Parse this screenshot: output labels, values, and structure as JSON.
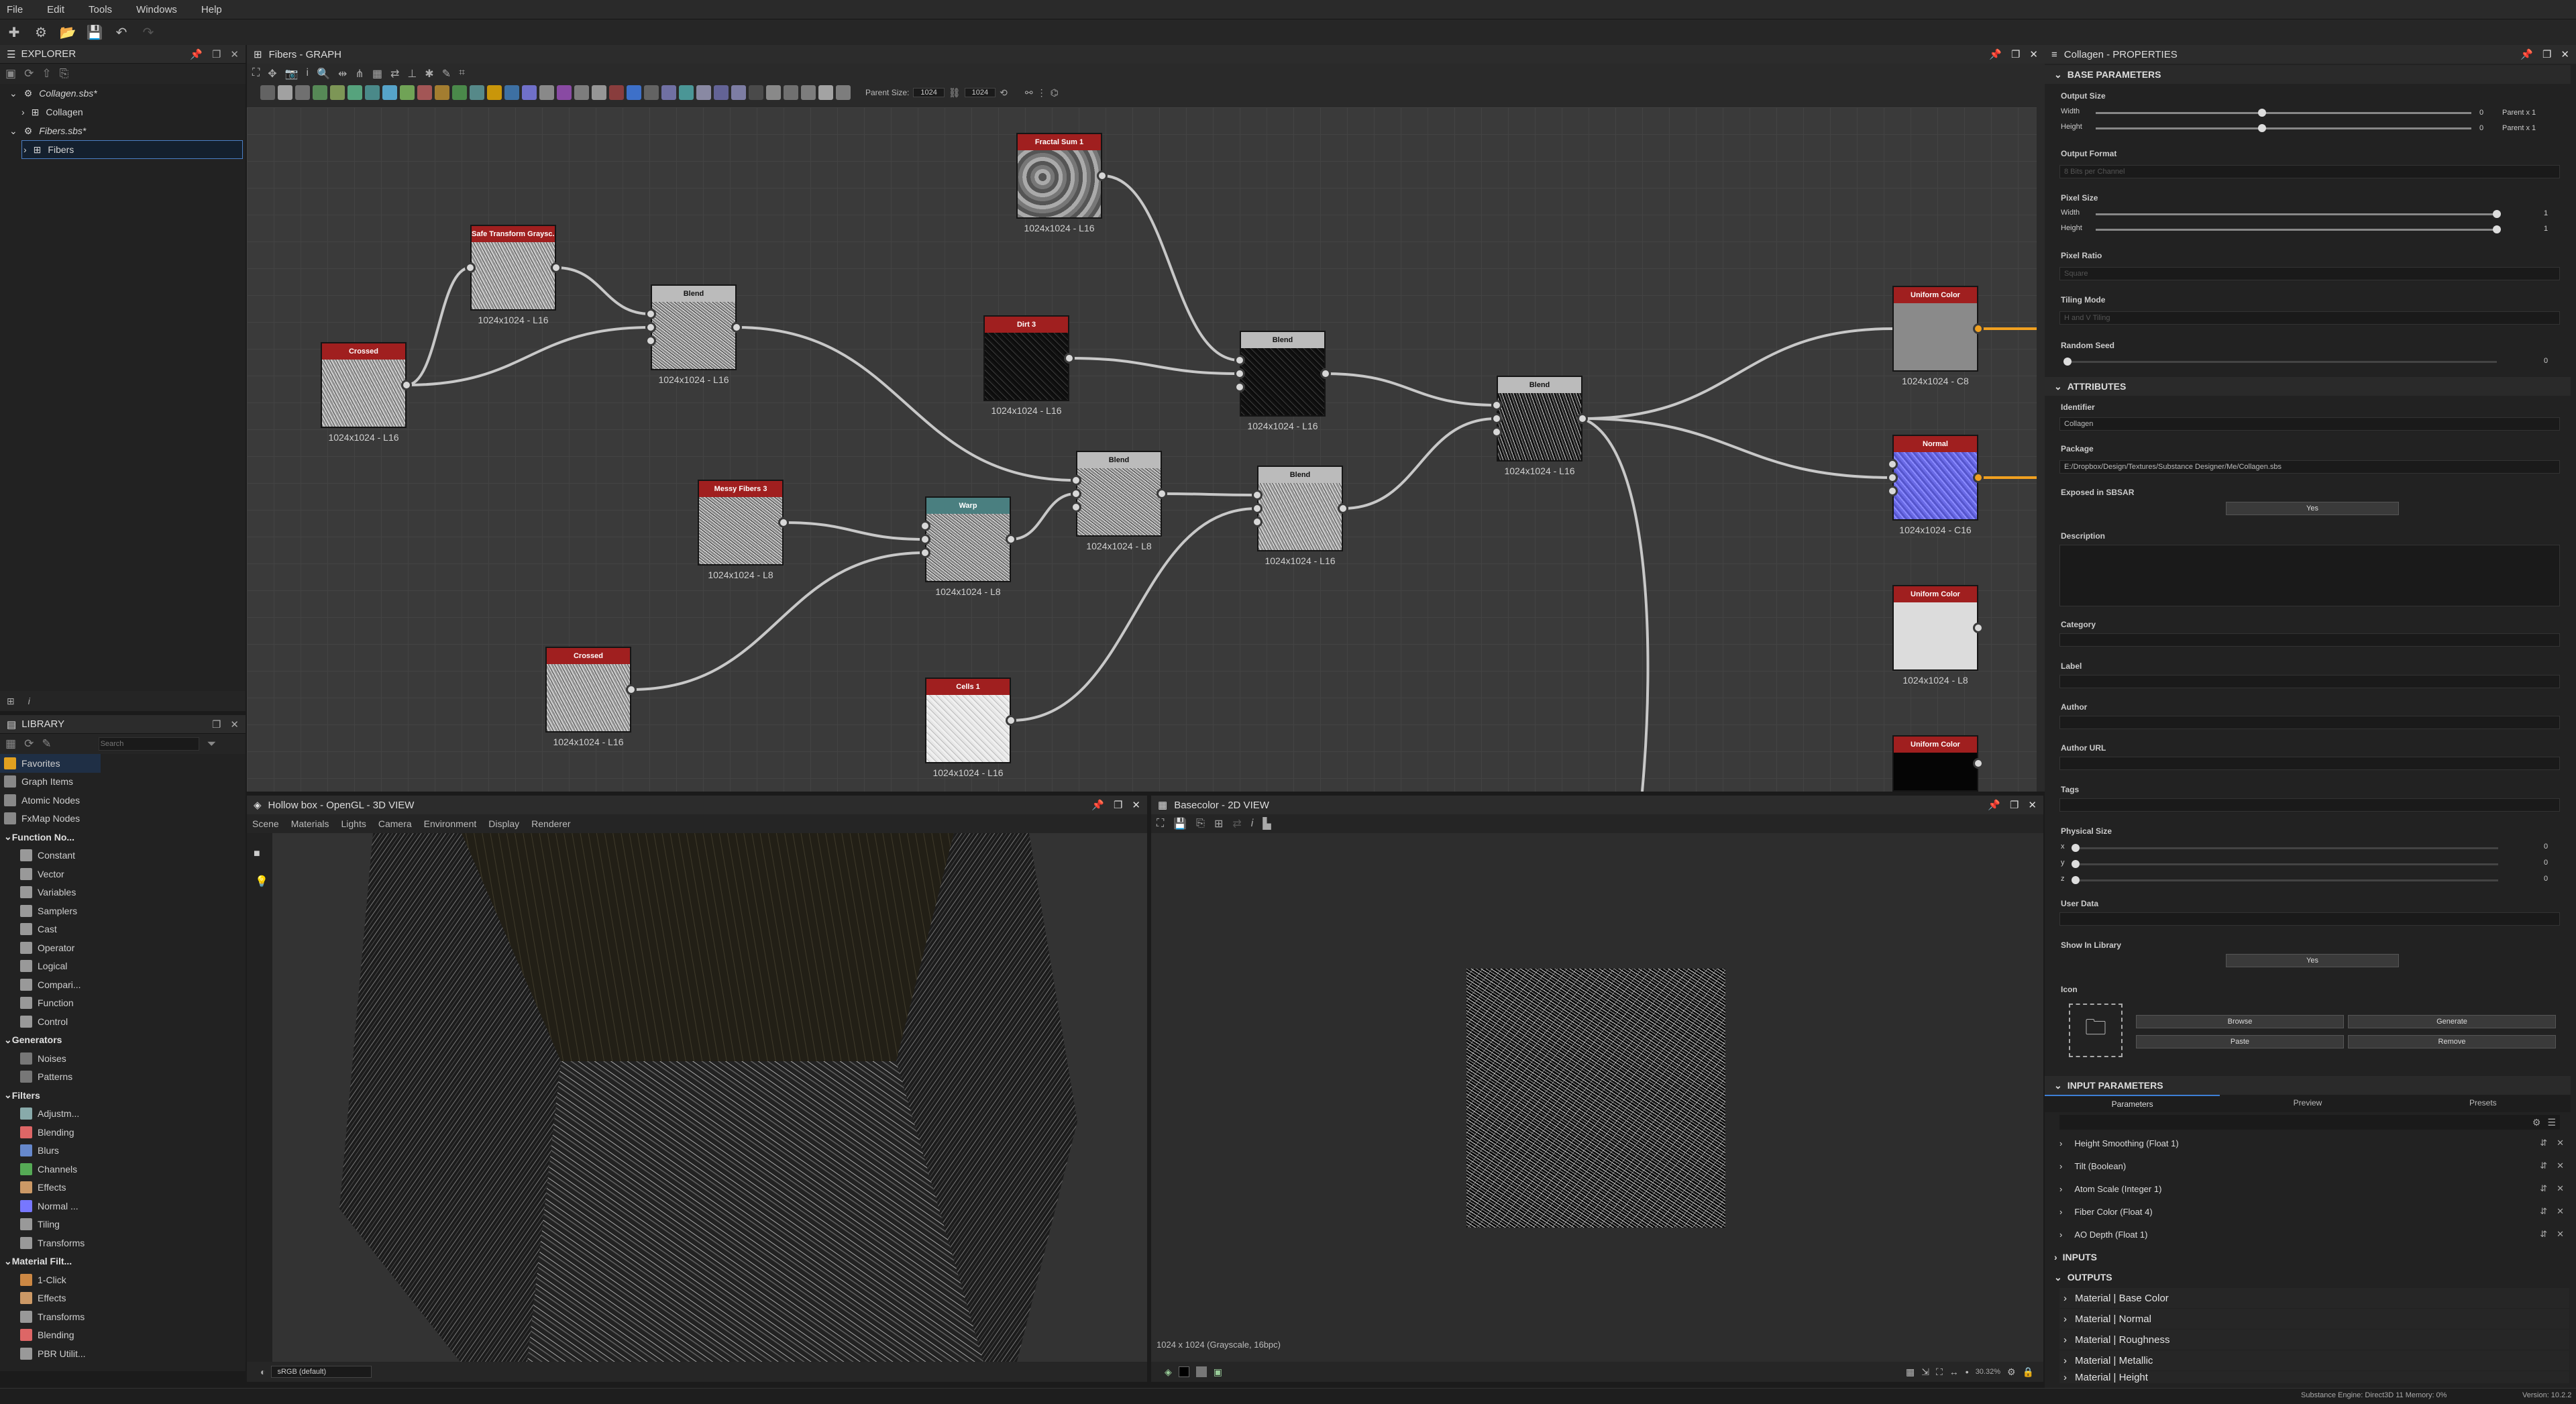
{
  "menu": [
    "File",
    "Edit",
    "Tools",
    "Windows",
    "Help"
  ],
  "explorer": {
    "title": "EXPLORER",
    "items": [
      {
        "label": "Collagen.sbs*"
      },
      {
        "label": "Collagen"
      },
      {
        "label": "Fibers.sbs*"
      },
      {
        "label": "Fibers"
      }
    ]
  },
  "library": {
    "title": "LIBRARY",
    "search_placeholder": "Search",
    "items": [
      {
        "label": "Favorites",
        "type": "item",
        "color": "#e0a020"
      },
      {
        "label": "Graph Items",
        "type": "item",
        "color": "#888"
      },
      {
        "label": "Atomic Nodes",
        "type": "item",
        "color": "#888"
      },
      {
        "label": "FxMap Nodes",
        "type": "item",
        "color": "#888"
      },
      {
        "label": "Function No...",
        "type": "cat",
        "color": "#888"
      },
      {
        "label": "Constant",
        "type": "sub",
        "color": "#999"
      },
      {
        "label": "Vector",
        "type": "sub",
        "color": "#999"
      },
      {
        "label": "Variables",
        "type": "sub",
        "color": "#999"
      },
      {
        "label": "Samplers",
        "type": "sub",
        "color": "#999"
      },
      {
        "label": "Cast",
        "type": "sub",
        "color": "#999"
      },
      {
        "label": "Operator",
        "type": "sub",
        "color": "#999"
      },
      {
        "label": "Logical",
        "type": "sub",
        "color": "#999"
      },
      {
        "label": "Compari...",
        "type": "sub",
        "color": "#999"
      },
      {
        "label": "Function",
        "type": "sub",
        "color": "#999"
      },
      {
        "label": "Control",
        "type": "sub",
        "color": "#999"
      },
      {
        "label": "Generators",
        "type": "cat",
        "color": "#888"
      },
      {
        "label": "Noises",
        "type": "sub",
        "color": "#777"
      },
      {
        "label": "Patterns",
        "type": "sub",
        "color": "#777"
      },
      {
        "label": "Filters",
        "type": "cat",
        "color": "#888"
      },
      {
        "label": "Adjustm...",
        "type": "sub",
        "color": "#8aa"
      },
      {
        "label": "Blending",
        "type": "sub",
        "color": "#d66"
      },
      {
        "label": "Blurs",
        "type": "sub",
        "color": "#68c"
      },
      {
        "label": "Channels",
        "type": "sub",
        "color": "#5a5"
      },
      {
        "label": "Effects",
        "type": "sub",
        "color": "#c96"
      },
      {
        "label": "Normal ...",
        "type": "sub",
        "color": "#77f"
      },
      {
        "label": "Tiling",
        "type": "sub",
        "color": "#999"
      },
      {
        "label": "Transforms",
        "type": "sub",
        "color": "#999"
      },
      {
        "label": "Material Filt...",
        "type": "cat",
        "color": "#888"
      },
      {
        "label": "1-Click",
        "type": "sub",
        "color": "#c84"
      },
      {
        "label": "Effects",
        "type": "sub",
        "color": "#c96"
      },
      {
        "label": "Transforms",
        "type": "sub",
        "color": "#999"
      },
      {
        "label": "Blending",
        "type": "sub",
        "color": "#d66"
      },
      {
        "label": "PBR Utilit...",
        "type": "sub",
        "color": "#999"
      }
    ]
  },
  "graph": {
    "title": "Fibers - GRAPH",
    "parent_size_label": "Parent Size:",
    "parent_size_w": "1024",
    "parent_size_h": "1024",
    "nodes": [
      {
        "id": "fractal",
        "title": "Fractal Sum 1",
        "label": "1024x1024 - L16",
        "color": "#a01f1f",
        "tex": "fractal"
      },
      {
        "id": "safe",
        "title": "Safe Transform Graysc...",
        "label": "1024x1024 - L16",
        "color": "#a01f1f",
        "tex": "fibers"
      },
      {
        "id": "crossed1",
        "title": "Crossed",
        "label": "1024x1024 - L16",
        "color": "#a01f1f",
        "tex": "fibers"
      },
      {
        "id": "blend1",
        "title": "Blend",
        "label": "1024x1024 - L16",
        "color": "#bbbbbb",
        "tex": "fibers2"
      },
      {
        "id": "dirt",
        "title": "Dirt 3",
        "label": "1024x1024 - L16",
        "color": "#a01f1f",
        "tex": "dark"
      },
      {
        "id": "blend2",
        "title": "Blend",
        "label": "1024x1024 - L16",
        "color": "#bbbbbb",
        "tex": "dark"
      },
      {
        "id": "messy",
        "title": "Messy Fibers 3",
        "label": "1024x1024 - L8",
        "color": "#a01f1f",
        "tex": "fibers2"
      },
      {
        "id": "warp",
        "title": "Warp",
        "label": "1024x1024 - L8",
        "color": "#4a7f80",
        "tex": "fibers2"
      },
      {
        "id": "blend3",
        "title": "Blend",
        "label": "1024x1024 - L8",
        "color": "#bbbbbb",
        "tex": "fibers2"
      },
      {
        "id": "blend4",
        "title": "Blend",
        "label": "1024x1024 - L16",
        "color": "#bbbbbb",
        "tex": "fibers"
      },
      {
        "id": "blend5",
        "title": "Blend",
        "label": "1024x1024 - L16",
        "color": "#bbbbbb",
        "tex": "darkfib"
      },
      {
        "id": "crossed2",
        "title": "Crossed",
        "label": "1024x1024 - L16",
        "color": "#a01f1f",
        "tex": "fibers"
      },
      {
        "id": "cells",
        "title": "Cells 1",
        "label": "1024x1024 - L16",
        "color": "#a01f1f",
        "tex": "light"
      },
      {
        "id": "uc1",
        "title": "Uniform Color",
        "label": "1024x1024 - C8",
        "color": "#a01f1f",
        "tex": "gray"
      },
      {
        "id": "normal",
        "title": "Normal",
        "label": "1024x1024 - C16",
        "color": "#a01f1f",
        "tex": "normal"
      },
      {
        "id": "uc2",
        "title": "Uniform Color",
        "label": "1024x1024 - L8",
        "color": "#a01f1f",
        "tex": "white"
      },
      {
        "id": "uc3",
        "title": "Uniform Color",
        "label": "",
        "color": "#a01f1f",
        "tex": "black"
      }
    ]
  },
  "view3d": {
    "title": "Hollow box - OpenGL - 3D VIEW",
    "menu": [
      "Scene",
      "Materials",
      "Lights",
      "Camera",
      "Environment",
      "Display",
      "Renderer"
    ],
    "colorspace": "sRGB (default)"
  },
  "view2d": {
    "title": "Basecolor - 2D VIEW",
    "info": "1024 x 1024 (Grayscale, 16bpc)",
    "zoom": "30.32%"
  },
  "props": {
    "title": "Collagen - PROPERTIES",
    "base_parameters": "BASE PARAMETERS",
    "output_size": "Output Size",
    "width": "Width",
    "height": "Height",
    "w_val": "0",
    "w_rel": "Parent x 1",
    "h_val": "0",
    "h_rel": "Parent x 1",
    "output_format": "Output Format",
    "output_format_val": "8 Bits per Channel",
    "pixel_size": "Pixel Size",
    "ps_w": "1",
    "ps_h": "1",
    "pixel_ratio": "Pixel Ratio",
    "pixel_ratio_val": "Square",
    "tiling_mode": "Tiling Mode",
    "tiling_mode_val": "H and V Tiling",
    "random_seed": "Random Seed",
    "random_seed_val": "0",
    "attributes": "ATTRIBUTES",
    "identifier": "Identifier",
    "identifier_val": "Collagen",
    "package": "Package",
    "package_val": "E:/Dropbox/Design/Textures/Substance Designer/Me/Collagen.sbs",
    "exposed": "Exposed in SBSAR",
    "exposed_val": "Yes",
    "description": "Description",
    "category": "Category",
    "label": "Label",
    "author": "Author",
    "author_url": "Author URL",
    "tags": "Tags",
    "physical_size": "Physical Size",
    "phys": [
      {
        "axis": "x",
        "val": "0"
      },
      {
        "axis": "y",
        "val": "0"
      },
      {
        "axis": "z",
        "val": "0"
      }
    ],
    "user_data": "User Data",
    "show_in_library": "Show In Library",
    "show_val": "Yes",
    "icon": "Icon",
    "browse": "Browse",
    "generate": "Generate",
    "paste": "Paste",
    "remove": "Remove",
    "input_parameters": "INPUT PARAMETERS",
    "tabs": [
      "Parameters",
      "Preview",
      "Presets"
    ],
    "params": [
      "Height Smoothing (Float 1)",
      "Tilt (Boolean)",
      "Atom Scale (Integer 1)",
      "Fiber Color (Float 4)",
      "AO Depth (Float 1)"
    ],
    "inputs": "INPUTS",
    "outputs": "OUTPUTS",
    "output_items": [
      "Material | Base Color",
      "Material | Normal",
      "Material | Roughness",
      "Material | Metallic",
      "Material | Height"
    ]
  },
  "status": {
    "engine": "Substance Engine: Direct3D 11  Memory: 0%",
    "version": "Version: 10.2.2"
  }
}
